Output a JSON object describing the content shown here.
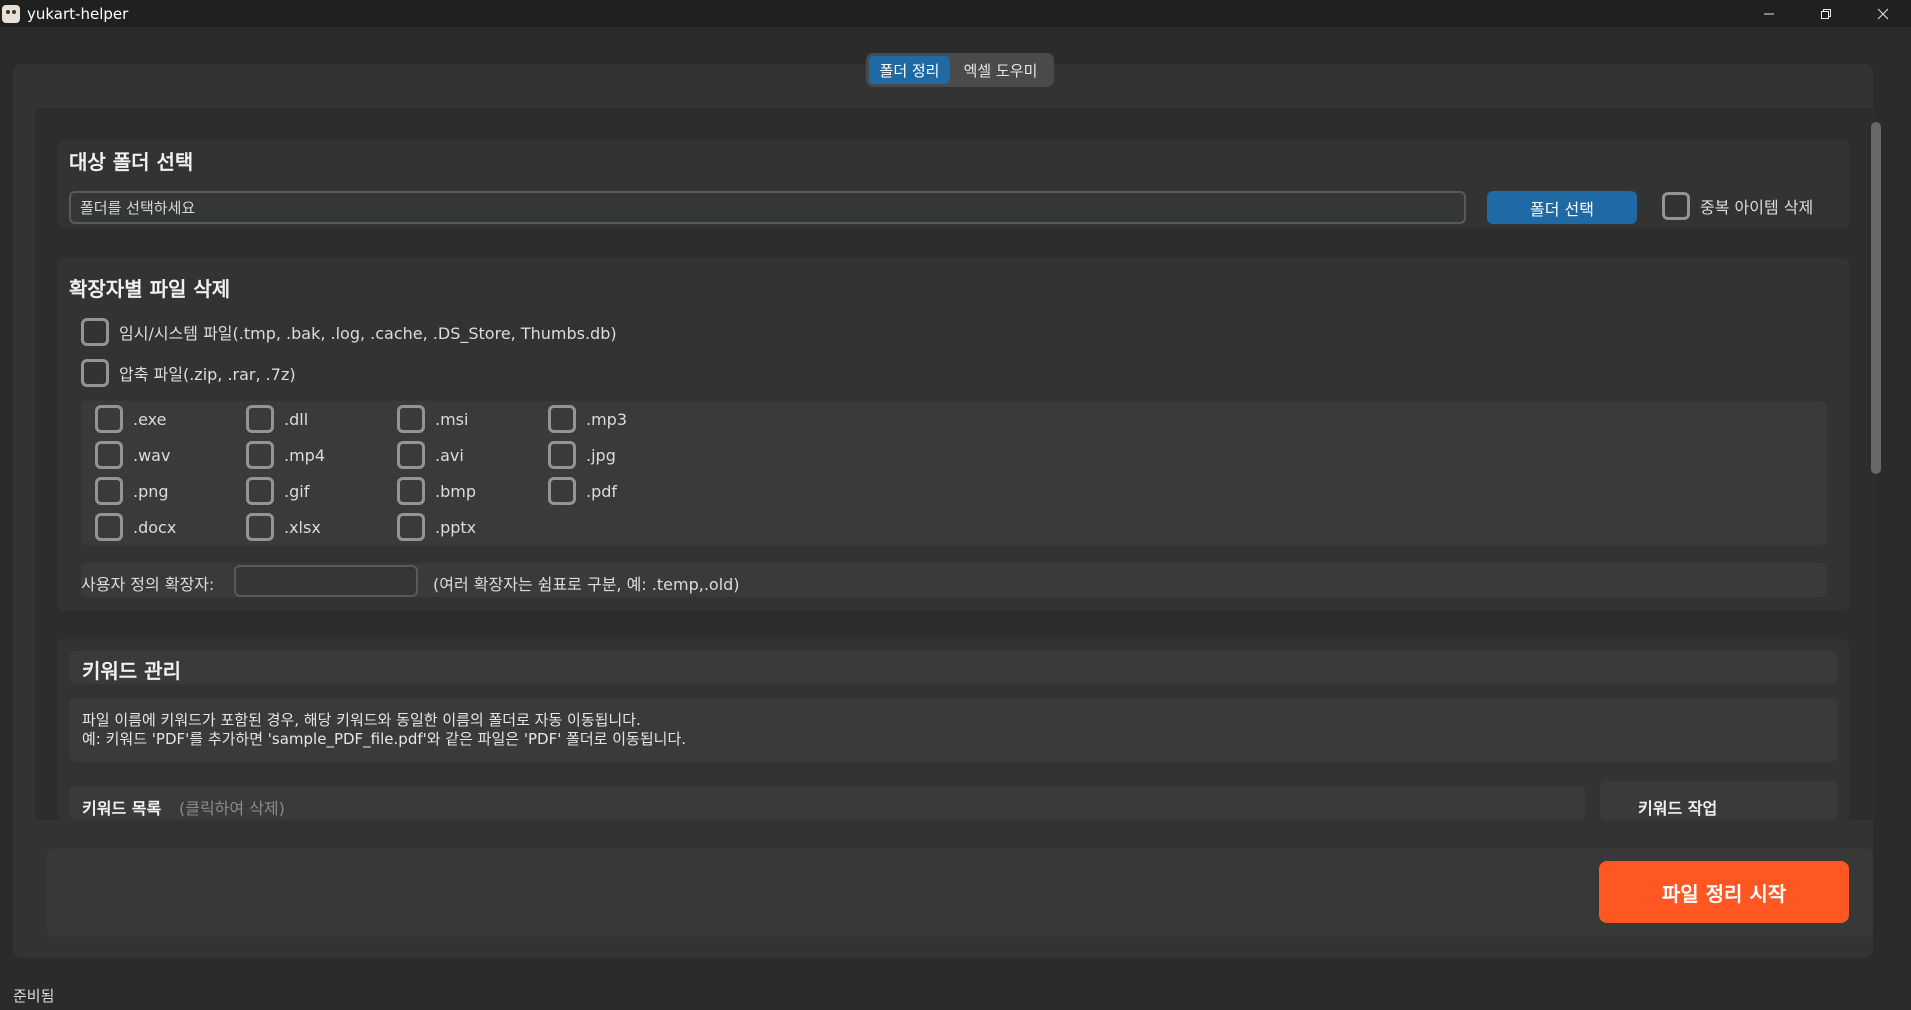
{
  "window": {
    "title": "yukart-helper",
    "controls": {
      "minimize": "─",
      "restore": "❐",
      "close": "✕"
    }
  },
  "tabs": [
    {
      "label": "폴더 정리",
      "active": true
    },
    {
      "label": "엑셀 도우미",
      "active": false
    }
  ],
  "target_folder": {
    "title": "대상 폴더 선택",
    "input_placeholder": "폴더를 선택하세요",
    "input_value": "",
    "select_button": "폴더 선택",
    "dup_delete_label": "중복 아이템 삭제",
    "dup_delete_checked": false
  },
  "extension_delete": {
    "title": "확장자별 파일 삭제",
    "temp_files_label": "임시/시스템 파일(.tmp, .bak, .log, .cache, .DS_Store, Thumbs.db)",
    "archive_files_label": "압축 파일(.zip, .rar, .7z)",
    "extensions": [
      [
        ".exe",
        ".dll",
        ".msi",
        ".mp3"
      ],
      [
        ".wav",
        ".mp4",
        ".avi",
        ".jpg"
      ],
      [
        ".png",
        ".gif",
        ".bmp",
        ".pdf"
      ],
      [
        ".docx",
        ".xlsx",
        ".pptx"
      ]
    ],
    "custom_label": "사용자 정의 확장자:",
    "custom_value": "",
    "custom_hint": "(여러 확장자는 쉼표로 구분, 예: .temp,.old)"
  },
  "keyword": {
    "title": "키워드 관리",
    "desc_line1": "파일 이름에 키워드가 포함된 경우, 해당 키워드와 동일한 이름의 폴더로 자동 이동됩니다.",
    "desc_line2": "예: 키워드 'PDF'를 추가하면 'sample_PDF_file.pdf'와 같은 파일은 'PDF' 폴더로 이동됩니다.",
    "list_title": "키워드 목록",
    "list_hint": "(클릭하여 삭제)",
    "actions_title": "키워드 작업"
  },
  "start_button": "파일 정리 시작",
  "status": "준비됨",
  "colors": {
    "accent_blue": "#1f6aa5",
    "start_orange": "#ff5722",
    "background": "#2b2b2b"
  }
}
